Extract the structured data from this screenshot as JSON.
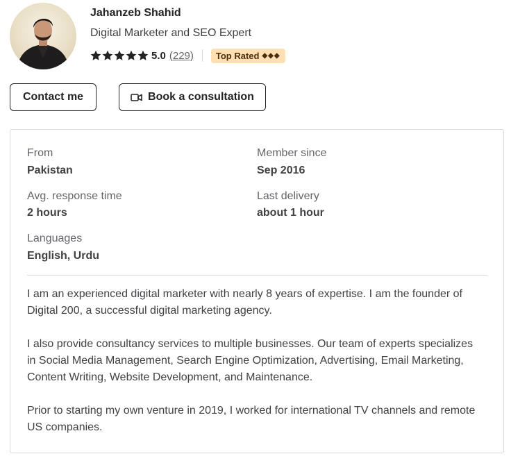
{
  "profile": {
    "name": "Jahanzeb Shahid",
    "title": "Digital Marketer and SEO Expert",
    "rating": "5.0",
    "rating_count": "(229)",
    "stars": 5,
    "badge": "Top Rated",
    "badge_diamonds": "◆◆◆"
  },
  "actions": {
    "contact_label": "Contact me",
    "book_label": "Book a consultation",
    "book_icon": "video-icon"
  },
  "stats": {
    "from_label": "From",
    "from_value": "Pakistan",
    "member_label": "Member since",
    "member_value": "Sep 2016",
    "response_label": "Avg. response time",
    "response_value": "2 hours",
    "delivery_label": "Last delivery",
    "delivery_value": "about 1 hour",
    "languages_label": "Languages",
    "languages_value": "English, Urdu"
  },
  "bio": [
    "I am an experienced digital marketer with nearly 8 years of expertise. I am the founder of Digital 200, a successful digital marketing agency.",
    "I also provide consultancy services to multiple businesses. Our team of experts specializes in Social Media Management, Search Engine Optimization, Advertising, Email Marketing, Content Writing, Website Development, and Maintenance.",
    "Prior to starting my own venture in 2019, I worked for international TV channels and remote US companies."
  ],
  "colors": {
    "text_dark": "#222325",
    "text_body": "#404145",
    "text_muted": "#62646a",
    "border": "#dadbdd",
    "badge_bg": "#ffe0b3",
    "badge_text": "#4f2d0c"
  }
}
